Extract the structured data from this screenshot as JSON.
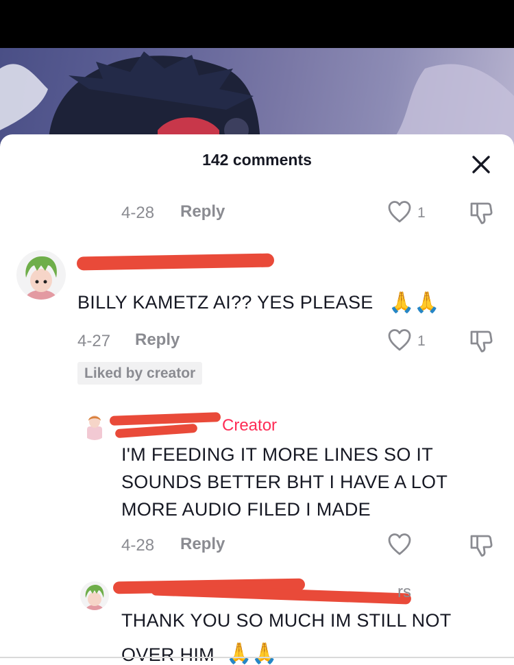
{
  "sheet": {
    "comment_count": "142 comments"
  },
  "comments": [
    {
      "date": "4-28",
      "reply": "Reply",
      "likes": "1"
    },
    {
      "text": "BILLY KAMETZ AI?? YES PLEASE",
      "emoji": "🙏🙏",
      "date": "4-27",
      "reply": "Reply",
      "likes": "1",
      "badge": "Liked by creator"
    },
    {
      "creator_label": "Creator",
      "lines": [
        "I'M FEEDING IT MORE LINES SO IT",
        "SOUNDS BETTER BHT I HAVE A LOT",
        "MORE AUDIO FILED I MADE"
      ],
      "date": "4-28",
      "reply": "Reply"
    },
    {
      "username_tail": "rs",
      "lines": [
        "THANK YOU SO MUCH IM STILL NOT",
        "OVER HIM"
      ],
      "emoji": "🙏🙏"
    }
  ],
  "colors": {
    "creator_accent": "#fe2c55",
    "redaction": "#e94a39",
    "muted": "#8a8b91"
  }
}
